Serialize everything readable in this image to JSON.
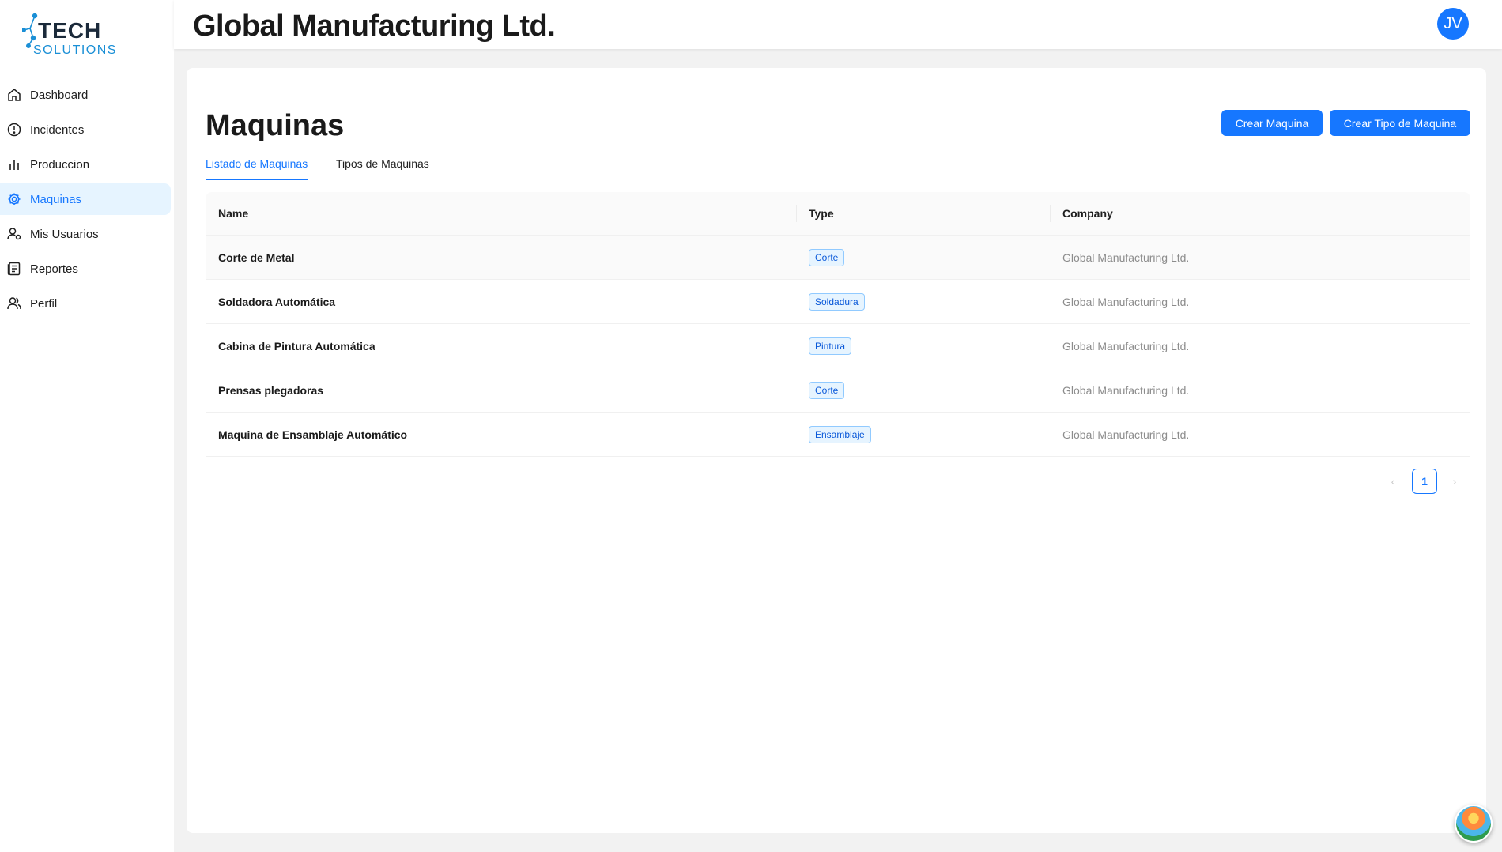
{
  "brand": {
    "line1": "TECH",
    "line2": "SOLUTIONS",
    "color": "#1a8fd6"
  },
  "sidebar": {
    "items": [
      {
        "label": "Dashboard",
        "icon": "home-icon"
      },
      {
        "label": "Incidentes",
        "icon": "alert-circle-icon"
      },
      {
        "label": "Produccion",
        "icon": "bar-chart-icon"
      },
      {
        "label": "Maquinas",
        "icon": "gear-icon",
        "active": true
      },
      {
        "label": "Mis Usuarios",
        "icon": "user-settings-icon"
      },
      {
        "label": "Reportes",
        "icon": "report-icon"
      },
      {
        "label": "Perfil",
        "icon": "users-icon"
      }
    ]
  },
  "header": {
    "title": "Global Manufacturing Ltd.",
    "avatar": "JV"
  },
  "main": {
    "title": "Maquinas",
    "buttons": {
      "create": "Crear Maquina",
      "create_type": "Crear Tipo de Maquina"
    },
    "tabs": [
      {
        "label": "Listado de Maquinas",
        "active": true
      },
      {
        "label": "Tipos de Maquinas"
      }
    ],
    "table": {
      "columns": [
        "Name",
        "Type",
        "Company"
      ],
      "rows": [
        {
          "name": "Corte de Metal",
          "type": "Corte",
          "company": "Global Manufacturing Ltd."
        },
        {
          "name": "Soldadora Automática",
          "type": "Soldadura",
          "company": "Global Manufacturing Ltd."
        },
        {
          "name": "Cabina de Pintura Automática",
          "type": "Pintura",
          "company": "Global Manufacturing Ltd."
        },
        {
          "name": "Prensas plegadoras",
          "type": "Corte",
          "company": "Global Manufacturing Ltd."
        },
        {
          "name": "Maquina de Ensamblaje Automático",
          "type": "Ensamblaje",
          "company": "Global Manufacturing Ltd."
        }
      ]
    },
    "pagination": {
      "current": "1",
      "prev": "‹",
      "next": "›"
    }
  },
  "colors": {
    "primary": "#1677ff",
    "tag_bg": "#e6f4ff",
    "tag_border": "#91caff"
  }
}
